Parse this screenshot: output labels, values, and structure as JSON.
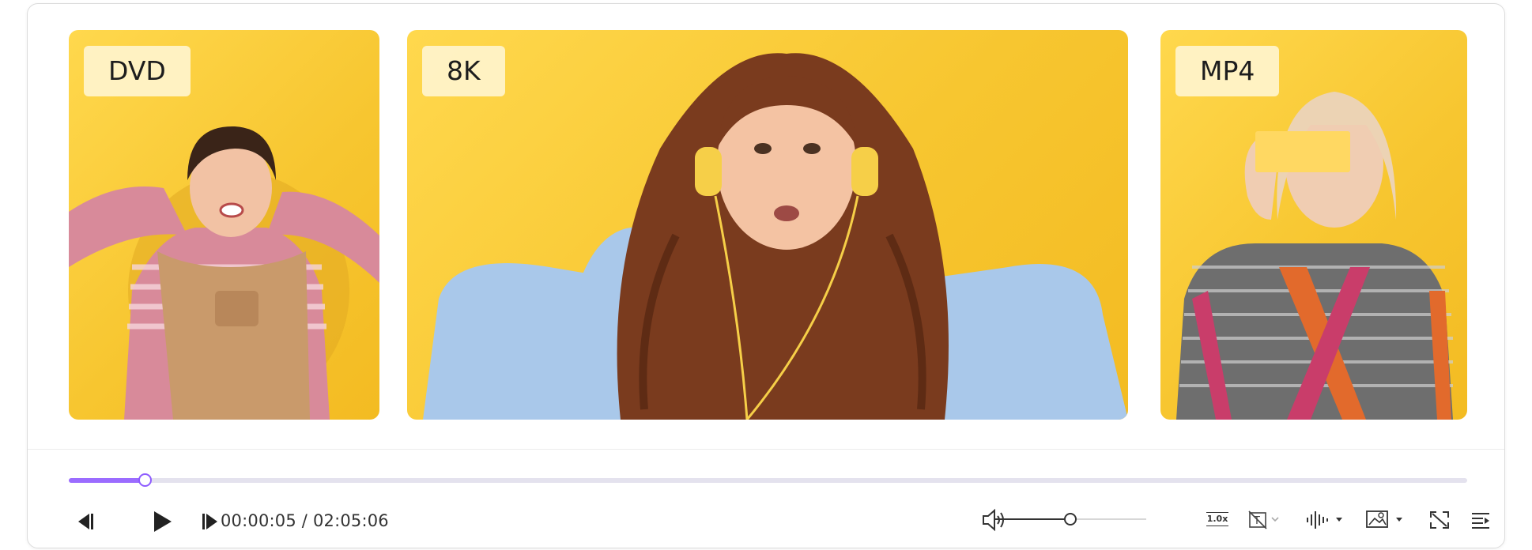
{
  "cards": [
    {
      "label": "DVD"
    },
    {
      "label": "8K"
    },
    {
      "label": "MP4"
    }
  ],
  "playback": {
    "current_time": "00:00:05",
    "total_time": "02:05:06",
    "time_display": "00:00:05 / 02:05:06",
    "progress_fraction": 0.054,
    "volume_fraction": 0.5,
    "speed_label": "1.0x"
  },
  "icons": {
    "prev_frame": "previous-frame-icon",
    "play": "play-icon",
    "next_frame": "next-frame-icon",
    "volume": "volume-icon",
    "speed": "playback-speed-icon",
    "subtitles": "subtitles-off-icon",
    "audio_track": "audio-track-icon",
    "snapshot": "snapshot-icon",
    "fullscreen": "fullscreen-icon",
    "playlist": "playlist-icon"
  },
  "colors": {
    "accent": "#9b6cff",
    "card_background": "#f7c630",
    "badge_background": "#fff4cd"
  }
}
